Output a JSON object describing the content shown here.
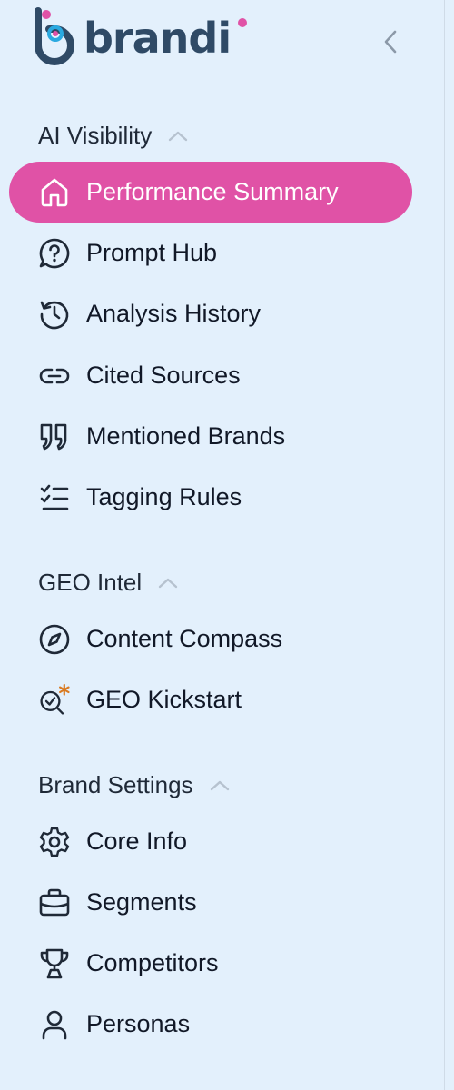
{
  "brand": {
    "name": "brandi",
    "accent": "#e052a6",
    "logo_color": "#2f4a66"
  },
  "collapse": {
    "icon": "chevron-left-icon"
  },
  "sections": [
    {
      "title": "AI Visibility",
      "items": [
        {
          "label": "Performance Summary",
          "icon": "home-icon",
          "active": true
        },
        {
          "label": "Prompt Hub",
          "icon": "question-chat-icon"
        },
        {
          "label": "Analysis History",
          "icon": "history-icon"
        },
        {
          "label": "Cited Sources",
          "icon": "link-icon"
        },
        {
          "label": "Mentioned Brands",
          "icon": "quote-icon"
        },
        {
          "label": "Tagging Rules",
          "icon": "checklist-icon"
        }
      ]
    },
    {
      "title": "GEO Intel",
      "items": [
        {
          "label": "Content Compass",
          "icon": "compass-icon"
        },
        {
          "label": "GEO Kickstart",
          "icon": "search-sparkle-icon"
        }
      ]
    },
    {
      "title": "Brand Settings",
      "items": [
        {
          "label": "Core Info",
          "icon": "gear-icon"
        },
        {
          "label": "Segments",
          "icon": "briefcase-icon"
        },
        {
          "label": "Competitors",
          "icon": "trophy-icon"
        },
        {
          "label": "Personas",
          "icon": "user-icon"
        }
      ]
    }
  ]
}
